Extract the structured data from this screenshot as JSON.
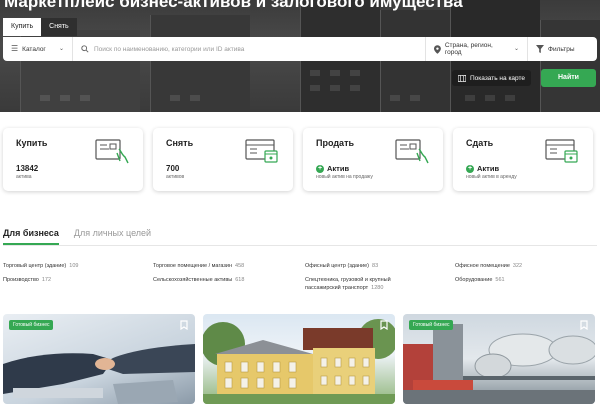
{
  "hero": {
    "headline": "Маркетплейс бизнес-активов и залогового имущества",
    "tabs": [
      {
        "label": "Купить",
        "active": true
      },
      {
        "label": "Снять",
        "active": false
      }
    ]
  },
  "search": {
    "catalog_label": "Каталог",
    "placeholder": "Поиск по наименованию, категории или ID актива",
    "location_label": "Страна, регион, город",
    "filters_label": "Фильтры",
    "map_button": "Показать на карте",
    "find_button": "Найти"
  },
  "cards": [
    {
      "title": "Купить",
      "count": "13842",
      "sub": "актива"
    },
    {
      "title": "Снять",
      "count": "700",
      "sub": "активов"
    },
    {
      "title": "Продать",
      "action": "Актив",
      "sub": "новый актив на продажу"
    },
    {
      "title": "Сдать",
      "action": "Актив",
      "sub": "новый актив в аренду"
    }
  ],
  "segments": {
    "business": "Для бизнеса",
    "personal": "Для личных целей"
  },
  "categories": [
    {
      "label": "Торговый центр (здание)",
      "count": "109"
    },
    {
      "label": "Производство",
      "count": "172"
    },
    {
      "label": "Торговое помещение / магазин",
      "count": "458"
    },
    {
      "label": "Сельскохозяйственные активы",
      "count": "618"
    },
    {
      "label": "Офисный центр (здание)",
      "count": "83"
    },
    {
      "label": "Спецтехника, грузовой и крупный пассажирский транспорт",
      "count": "1280"
    },
    {
      "label": "Офисное помещение",
      "count": "322"
    },
    {
      "label": "Оборудование",
      "count": "561"
    }
  ],
  "listings": [
    {
      "badge": "Готовый бизнес"
    },
    {
      "badge": ""
    },
    {
      "badge": "Готовый бизнес"
    }
  ],
  "colors": {
    "accent": "#35a853",
    "dark": "#1e1e1e"
  }
}
